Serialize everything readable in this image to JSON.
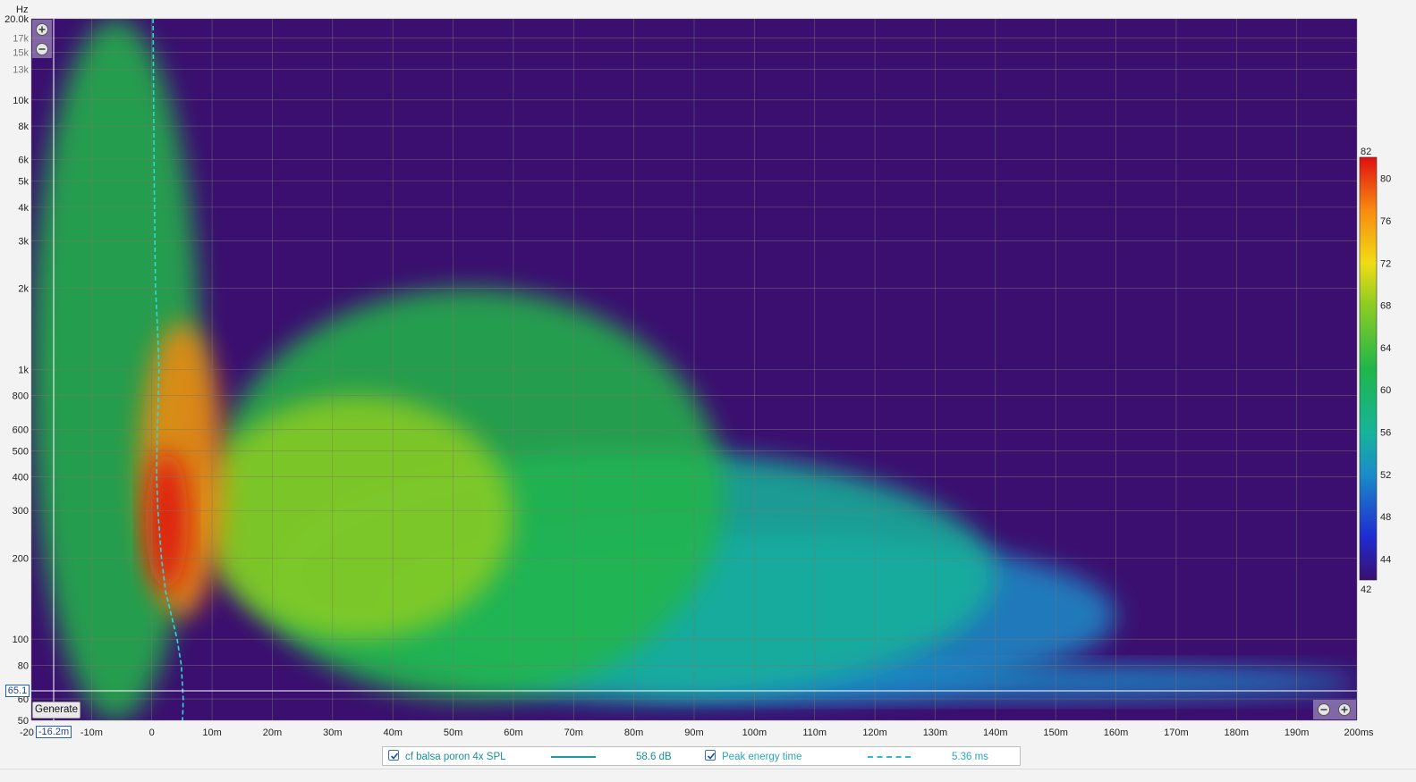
{
  "chart_data": {
    "type": "heatmap",
    "title": "",
    "xlabel": "",
    "ylabel": "Hz",
    "x_unit": "ms",
    "xlim": [
      -20,
      200
    ],
    "ylim": [
      50,
      20000
    ],
    "y_scale": "log",
    "x_ticks": [
      {
        "value": -20,
        "label": "-20"
      },
      {
        "value": -10,
        "label": "-10m"
      },
      {
        "value": 0,
        "label": "0"
      },
      {
        "value": 10,
        "label": "10m"
      },
      {
        "value": 20,
        "label": "20m"
      },
      {
        "value": 30,
        "label": "30m"
      },
      {
        "value": 40,
        "label": "40m"
      },
      {
        "value": 50,
        "label": "50m"
      },
      {
        "value": 60,
        "label": "60m"
      },
      {
        "value": 70,
        "label": "70m"
      },
      {
        "value": 80,
        "label": "80m"
      },
      {
        "value": 90,
        "label": "90m"
      },
      {
        "value": 100,
        "label": "100m"
      },
      {
        "value": 110,
        "label": "110m"
      },
      {
        "value": 120,
        "label": "120m"
      },
      {
        "value": 130,
        "label": "130m"
      },
      {
        "value": 140,
        "label": "140m"
      },
      {
        "value": 150,
        "label": "150m"
      },
      {
        "value": 160,
        "label": "160m"
      },
      {
        "value": 170,
        "label": "170m"
      },
      {
        "value": 180,
        "label": "180m"
      },
      {
        "value": 190,
        "label": "190m"
      },
      {
        "value": 200,
        "label": "200ms"
      }
    ],
    "y_ticks": [
      {
        "value": 20000,
        "label": "20.0k"
      },
      {
        "value": 17000,
        "label": "17k",
        "dim": true
      },
      {
        "value": 15000,
        "label": "15k",
        "dim": true
      },
      {
        "value": 13000,
        "label": "13k",
        "dim": true
      },
      {
        "value": 10000,
        "label": "10k"
      },
      {
        "value": 8000,
        "label": "8k"
      },
      {
        "value": 6000,
        "label": "6k"
      },
      {
        "value": 5000,
        "label": "5k"
      },
      {
        "value": 4000,
        "label": "4k"
      },
      {
        "value": 3000,
        "label": "3k"
      },
      {
        "value": 2000,
        "label": "2k"
      },
      {
        "value": 1000,
        "label": "1k"
      },
      {
        "value": 800,
        "label": "800"
      },
      {
        "value": 600,
        "label": "600"
      },
      {
        "value": 500,
        "label": "500"
      },
      {
        "value": 400,
        "label": "400"
      },
      {
        "value": 300,
        "label": "300"
      },
      {
        "value": 200,
        "label": "200"
      },
      {
        "value": 100,
        "label": "100"
      },
      {
        "value": 80,
        "label": "80"
      },
      {
        "value": 60,
        "label": "60"
      },
      {
        "value": 50,
        "label": "50"
      }
    ],
    "grid": true,
    "colorbar": {
      "min": 42,
      "max": 82,
      "ticks": [
        42,
        44,
        48,
        52,
        56,
        60,
        64,
        68,
        72,
        76,
        80,
        82
      ],
      "stops": [
        {
          "value": 42,
          "color": "#3b0f70"
        },
        {
          "value": 46,
          "color": "#1f2bd0"
        },
        {
          "value": 52,
          "color": "#1a8cc8"
        },
        {
          "value": 56,
          "color": "#16b49a"
        },
        {
          "value": 62,
          "color": "#20b64a"
        },
        {
          "value": 68,
          "color": "#8ccc22"
        },
        {
          "value": 72,
          "color": "#f0dc14"
        },
        {
          "value": 77,
          "color": "#f88a10"
        },
        {
          "value": 82,
          "color": "#e01010"
        }
      ]
    },
    "background_color": "#3b0f70",
    "peak_energy_curve": {
      "color": "#2fd8d8",
      "points": [
        {
          "f": 20000,
          "t": 0.2
        },
        {
          "f": 10000,
          "t": 0.3
        },
        {
          "f": 5000,
          "t": 0.4
        },
        {
          "f": 2000,
          "t": 0.6
        },
        {
          "f": 1500,
          "t": 0.9
        },
        {
          "f": 1000,
          "t": 1.2
        },
        {
          "f": 600,
          "t": 0.9
        },
        {
          "f": 400,
          "t": 0.8
        },
        {
          "f": 300,
          "t": 1.0
        },
        {
          "f": 200,
          "t": 1.6
        },
        {
          "f": 150,
          "t": 2.3
        },
        {
          "f": 100,
          "t": 4.2
        },
        {
          "f": 80,
          "t": 4.9
        },
        {
          "f": 60,
          "t": 5.2
        },
        {
          "f": 50,
          "t": 5.1
        }
      ]
    },
    "series": [
      {
        "name": "cf balsa poron 4x SPL",
        "value_label": "58.6 dB",
        "color": "#1a9a9a",
        "style": "solid"
      },
      {
        "name": "Peak energy time",
        "value_label": "5.36 ms",
        "color": "#2fbcc8",
        "style": "dashed"
      }
    ],
    "hot_regions": [
      {
        "t0": -20,
        "t1": 8,
        "f0": 50,
        "f1": 20000,
        "level": 62
      },
      {
        "t0": -2,
        "t1": 12,
        "f0": 120,
        "f1": 1500,
        "level": 76
      },
      {
        "t0": -1,
        "t1": 6,
        "f0": 150,
        "f1": 500,
        "level": 81
      },
      {
        "t0": 8,
        "t1": 60,
        "f0": 100,
        "f1": 800,
        "level": 68
      },
      {
        "t0": 10,
        "t1": 95,
        "f0": 60,
        "f1": 2000,
        "level": 60
      },
      {
        "t0": 20,
        "t1": 140,
        "f0": 60,
        "f1": 500,
        "level": 55
      },
      {
        "t0": 40,
        "t1": 160,
        "f0": 60,
        "f1": 250,
        "level": 50
      },
      {
        "t0": 80,
        "t1": 200,
        "f0": 60,
        "f1": 80,
        "level": 50
      }
    ]
  },
  "cursor": {
    "x_label": "-16.2m",
    "y_label": "65.1"
  },
  "controls": {
    "generate_label": "Generate"
  },
  "legend": {
    "items": [
      {
        "checked": true,
        "label": "cf balsa poron 4x SPL",
        "value": "58.6 dB"
      },
      {
        "checked": true,
        "label": "Peak energy time",
        "value": "5.36 ms"
      }
    ]
  }
}
